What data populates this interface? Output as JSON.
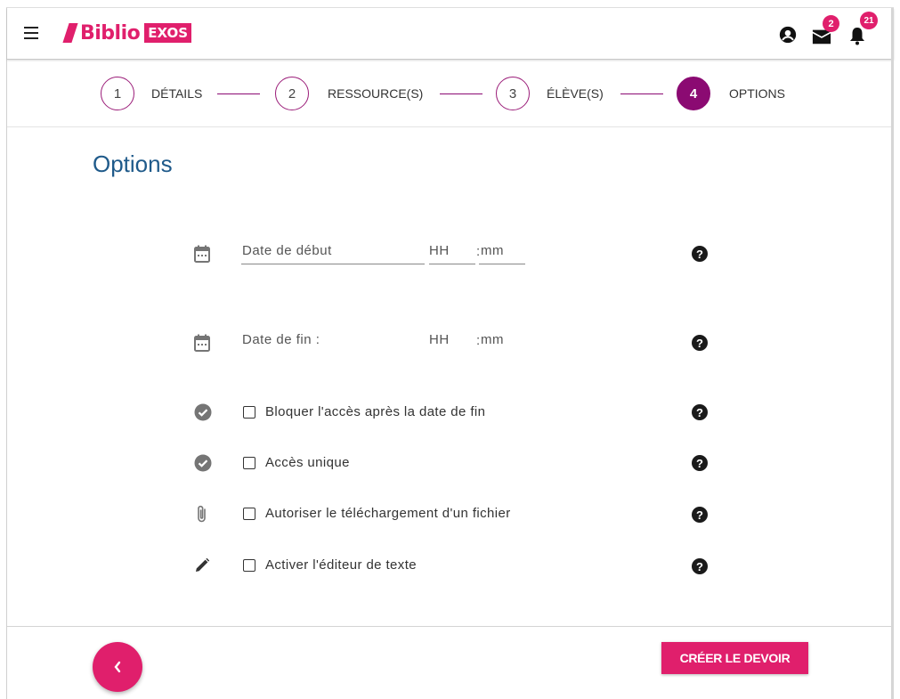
{
  "header": {
    "logo_text": "Biblio",
    "logo_badge": "EXOS",
    "messages_count": "2",
    "notifications_count": "21",
    "brand_color": "#e01f6c"
  },
  "stepper": {
    "steps": [
      {
        "number": "1",
        "label": "DÉTAILS"
      },
      {
        "number": "2",
        "label": "RESSOURCE(S)"
      },
      {
        "number": "3",
        "label": "ÉLÈVE(S)"
      },
      {
        "number": "4",
        "label": "OPTIONS",
        "active": true
      }
    ],
    "accent_color": "#8b0a72"
  },
  "main": {
    "title": "Options",
    "start_date": {
      "placeholder": "Date de début",
      "hours_placeholder": "HH",
      "separator": ":",
      "minutes_placeholder": "mm"
    },
    "end_date": {
      "label": "Date de fin :",
      "hours_placeholder": "HH",
      "separator": ":",
      "minutes_placeholder": "mm"
    },
    "options": [
      {
        "icon": "check-circle-icon",
        "label": "Bloquer l'accès après la date de fin",
        "checked": false
      },
      {
        "icon": "check-circle-icon",
        "label": "Accès unique",
        "checked": false
      },
      {
        "icon": "paperclip-icon",
        "label": "Autoriser le téléchargement d'un fichier",
        "checked": false
      },
      {
        "icon": "pencil-icon",
        "label": "Activer l'éditeur de texte",
        "checked": false
      }
    ],
    "help_glyph": "?"
  },
  "footer": {
    "back_glyph": "‹",
    "create_label": "CRÉER LE DEVOIR"
  }
}
